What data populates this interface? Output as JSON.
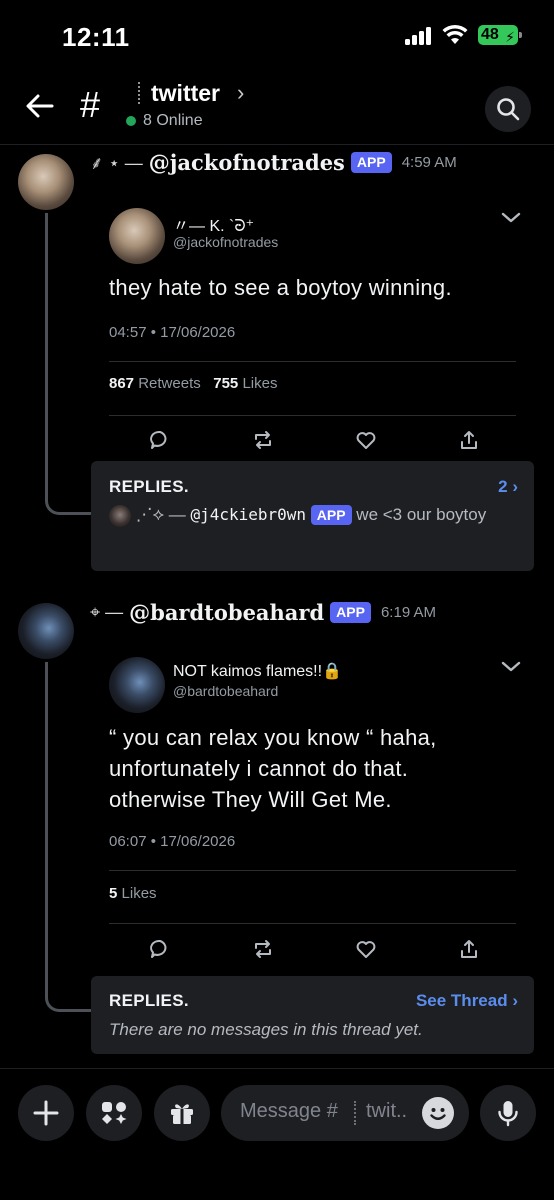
{
  "status_bar": {
    "time": "12:11",
    "battery": "48"
  },
  "header": {
    "channel_name": "twitter",
    "online_count": "8 Online"
  },
  "messages": [
    {
      "author_prefix": "⸙ ⋆  —",
      "author": "@jackofnotrades",
      "badge": "APP",
      "time": "4:59 AM",
      "embed": {
        "display_name": "〃— K. `ᘒ⁺",
        "handle": "@jackofnotrades",
        "text": "they hate to see a boytoy winning.",
        "date": "04:57 • 17/06/2026",
        "retweets": "867",
        "retweets_label": "Retweets",
        "likes": "755",
        "likes_label": "Likes"
      },
      "replies": {
        "title": "REPLIES.",
        "count_label": "2 ›",
        "preview_prefix": "⋰⟡ —",
        "preview_name": "@j4ckiebr0wn",
        "preview_badge": "APP",
        "preview_text": "we <3 our boytoy"
      }
    },
    {
      "author_prefix": "⌖  —",
      "author": "@bardtobeahard",
      "badge": "APP",
      "time": "6:19 AM",
      "embed": {
        "display_name": "NOT  kaimos  flames!!🔒",
        "handle": "@bardtobeahard",
        "text_line1": "“  you can relax you know  “ haha,",
        "text_line2": "unfortunately i cannot do that.",
        "text_line3": "otherwise They Will Get Me.",
        "date": "06:07 • 17/06/2026",
        "likes": "5",
        "likes_label": "Likes"
      },
      "replies": {
        "title": "REPLIES.",
        "see_thread": "See Thread ›",
        "empty_text": "There are no messages in this thread yet."
      }
    }
  ],
  "composer": {
    "placeholder_left": "Message #",
    "placeholder_right": "twit.."
  }
}
